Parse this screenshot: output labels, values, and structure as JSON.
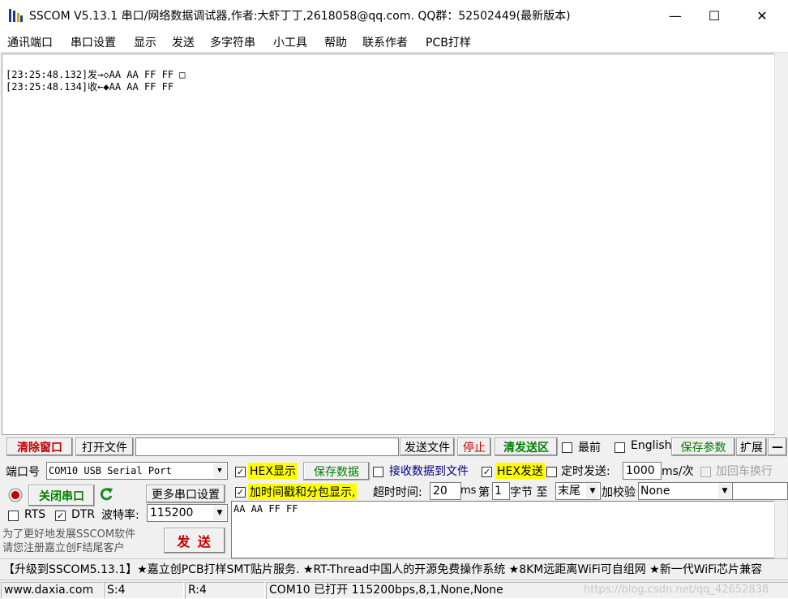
{
  "window": {
    "title": "SSCOM V5.13.1 串口/网络数据调试器,作者:大虾丁丁,2618058@qq.com. QQ群：52502449(最新版本)",
    "minimize": "—",
    "maximize": "☐",
    "close": "✕"
  },
  "menu": [
    "通讯端口",
    "串口设置",
    "显示",
    "发送",
    "多字符串",
    "小工具",
    "帮助",
    "联系作者",
    "PCB打样"
  ],
  "receive": {
    "lines": [
      "[23:25:48.132]发→◇AA AA FF FF □",
      "[23:25:48.134]收←◆AA AA FF FF"
    ]
  },
  "toolbar": {
    "clear_window": "清除窗口",
    "open_file": "打开文件",
    "file_path": "",
    "send_file": "发送文件",
    "stop": "停止",
    "clear_send": "清发送区",
    "topmost": "最前",
    "english": "English",
    "save_params": "保存参数",
    "expand": "扩展",
    "collapse": "—"
  },
  "port": {
    "port_label": "端口号",
    "port_value": "COM10 USB Serial Port",
    "close_port": "关闭串口",
    "more_settings": "更多串口设置",
    "rts": "RTS",
    "dtr": "DTR",
    "baud_label": "波特率:",
    "baud_value": "115200",
    "promo_line1": "为了更好地发展SSCOM软件",
    "promo_line2": "请您注册嘉立创F结尾客户",
    "send_button": "发 送"
  },
  "options": {
    "hex_display": "HEX显示",
    "save_data": "保存数据",
    "recv_to_file": "接收数据到文件",
    "hex_send": "HEX发送",
    "timed_send": "定时发送:",
    "interval_value": "1000",
    "interval_unit": "ms/次",
    "add_crlf": "加回车换行",
    "timestamp": "加时间戳和分包显示,",
    "timeout_label": "超时时间:",
    "timeout_value": "20",
    "timeout_unit": "ms",
    "byte_prefix": "第",
    "byte_index": "1",
    "byte_suffix": "字节 至",
    "byte_to": "末尾",
    "checksum_label": "加校验",
    "checksum_value": "None"
  },
  "send_area": {
    "text": "AA AA FF FF"
  },
  "ticker": "【升级到SSCOM5.13.1】★嘉立创PCB打样SMT贴片服务. ★RT-Thread中国人的开源免费操作系统 ★8KM远距离WiFi可自组网 ★新一代WiFi芯片兼容",
  "status": {
    "website": "www.daxia.com",
    "sent": "S:4",
    "received": "R:4",
    "port_status": "COM10 已打开  115200bps,8,1,None,None",
    "watermark": "https://blog.csdn.net/qq_42652838"
  },
  "colors": {
    "highlight_yellow": "#ffff00",
    "green_text": "#008000",
    "red_text": "#c00000"
  }
}
